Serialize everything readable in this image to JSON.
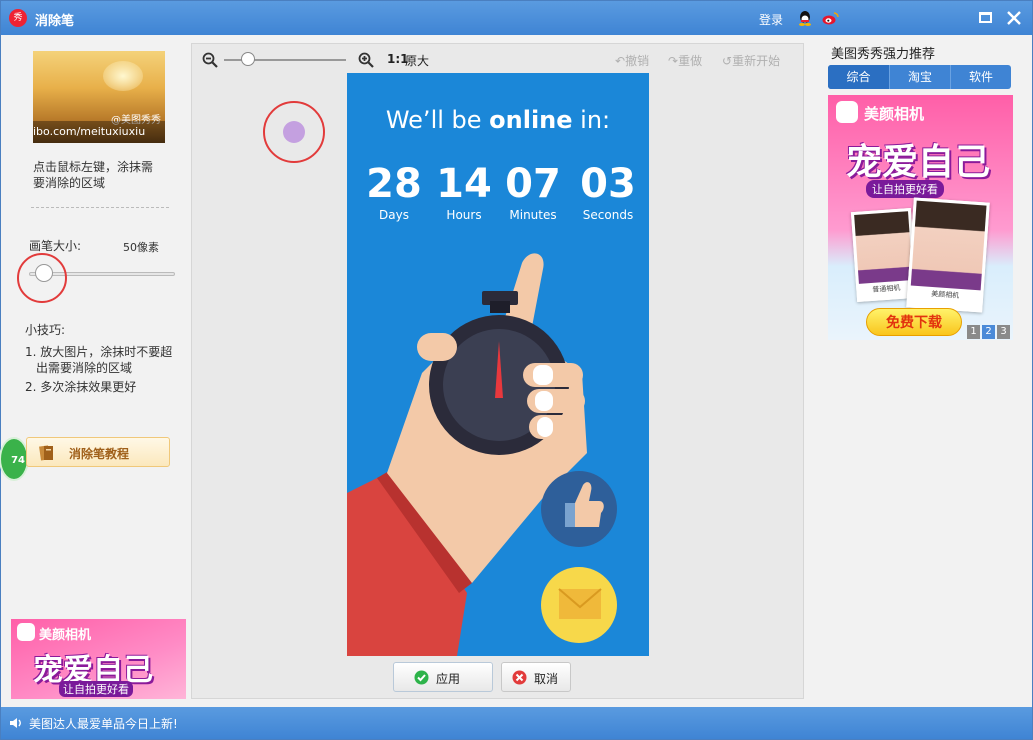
{
  "window": {
    "title": "消除笔",
    "login": "登录",
    "logo_text": "秀"
  },
  "left": {
    "preview_watermark": "ibo.com/meituxiuxiu",
    "preview_tag": "@美图秀秀",
    "hint": "点击鼠标左键，涂抹需要消除的区域",
    "brush_label": "画笔大小:",
    "brush_value": "50像素",
    "brush_level": 0.1,
    "tips_title": "小技巧:",
    "tip1_line1": "1. 放大图片，涂抹时不要超",
    "tip1_line2": "出需要消除的区域",
    "tip2": "2. 多次涂抹效果更好",
    "tutorial_label": "消除笔教程",
    "badge": "74",
    "ad_brand": "美颜相机",
    "ad_slogan": "宠爱自己",
    "ad_sub": "让自拍更好看"
  },
  "canvas": {
    "zoom_level": 0.2,
    "ratio": "1:1",
    "ratio_label": "原大",
    "undo": "撤销",
    "redo": "重做",
    "restart": "重新开始",
    "apply": "应用",
    "cancel": "取消",
    "poster": {
      "headline_pre": "We’ll be ",
      "headline_bold": "online",
      "headline_post": " in:",
      "countdown": [
        {
          "value": "28",
          "label": "Days"
        },
        {
          "value": "14",
          "label": "Hours"
        },
        {
          "value": "07",
          "label": "Minutes"
        },
        {
          "value": "03",
          "label": "Seconds"
        }
      ]
    }
  },
  "right": {
    "title": "美图秀秀强力推荐",
    "tabs": [
      "综合",
      "淘宝",
      "软件"
    ],
    "ad_brand": "美颜相机",
    "ad_slogan": "宠爱自己",
    "ad_sub": "让自拍更好看",
    "ad_caption_1": "普通相机",
    "ad_caption_2": "美颜相机",
    "download": "免费下载",
    "pages": [
      "1",
      "2",
      "3"
    ]
  },
  "status": {
    "text": "美图达人最爱单品今日上新!"
  },
  "colors": {
    "titlebar": "#3f84d4",
    "poster_bg": "#1b87d8",
    "accent_red": "#e23b3b",
    "ad_pink": "#ff5fa8"
  }
}
